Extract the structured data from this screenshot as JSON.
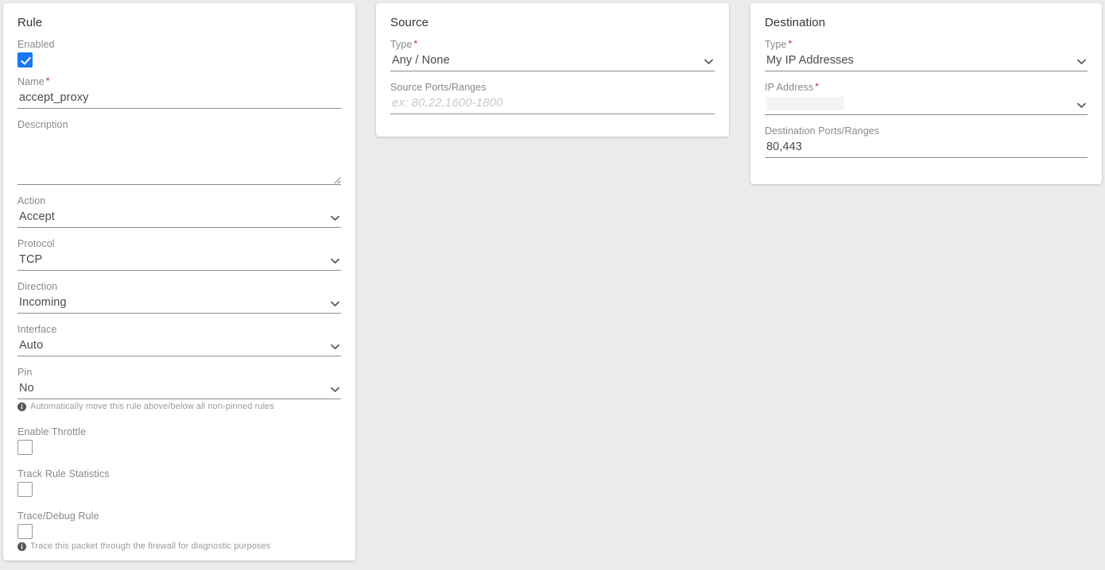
{
  "theme": {
    "page_background": "#ebebeb",
    "card_background": "#ffffff",
    "accent_checkbox": "#1877f2",
    "required_marker": "#b5252b",
    "label_color": "#888888",
    "value_color": "#4a4a4a",
    "underline_color": "#8a8a8a",
    "hint_color": "#9b9b9b",
    "redaction_color": "#f4f4f4"
  },
  "required_marker": "*",
  "rule_card": {
    "title": "Rule",
    "enabled": {
      "label": "Enabled",
      "checked": true,
      "icon": "checkbox-checked-icon"
    },
    "name": {
      "label": "Name",
      "required": true,
      "value": "accept_proxy",
      "placeholder": ""
    },
    "description": {
      "label": "Description",
      "required": false,
      "value": "",
      "placeholder": ""
    },
    "action": {
      "label": "Action",
      "required": false,
      "value": "Accept",
      "icon": "chevron-down-icon"
    },
    "protocol": {
      "label": "Protocol",
      "required": false,
      "value": "TCP",
      "icon": "chevron-down-icon"
    },
    "direction": {
      "label": "Direction",
      "required": false,
      "value": "Incoming",
      "icon": "chevron-down-icon"
    },
    "interface": {
      "label": "Interface",
      "required": false,
      "value": "Auto",
      "icon": "chevron-down-icon"
    },
    "pin": {
      "label": "Pin",
      "required": false,
      "value": "No",
      "icon": "chevron-down-icon",
      "hint": "Automatically move this rule above/below all non-pinned rules",
      "hint_icon": "info-icon"
    },
    "enable_throttle": {
      "label": "Enable Throttle",
      "checked": false,
      "icon": "checkbox-unchecked-icon"
    },
    "track_rule_statistics": {
      "label": "Track Rule Statistics",
      "checked": false,
      "icon": "checkbox-unchecked-icon"
    },
    "trace_debug_rule": {
      "label": "Trace/Debug Rule",
      "checked": false,
      "icon": "checkbox-unchecked-icon",
      "hint": "Trace this packet through the firewall for diagnostic purposes",
      "hint_icon": "info-icon"
    }
  },
  "source_card": {
    "title": "Source",
    "type": {
      "label": "Type",
      "required": true,
      "value": "Any / None",
      "icon": "chevron-down-icon"
    },
    "ports": {
      "label": "Source Ports/Ranges",
      "required": false,
      "value": "",
      "placeholder": "ex: 80,22,1600-1800"
    }
  },
  "destination_card": {
    "title": "Destination",
    "type": {
      "label": "Type",
      "required": true,
      "value": "My IP Addresses",
      "icon": "chevron-down-icon"
    },
    "ip_address": {
      "label": "IP Address",
      "required": true,
      "value": "",
      "redacted": true,
      "icon": "chevron-down-icon"
    },
    "ports": {
      "label": "Destination Ports/Ranges",
      "required": false,
      "value": "80,443",
      "placeholder": ""
    }
  }
}
